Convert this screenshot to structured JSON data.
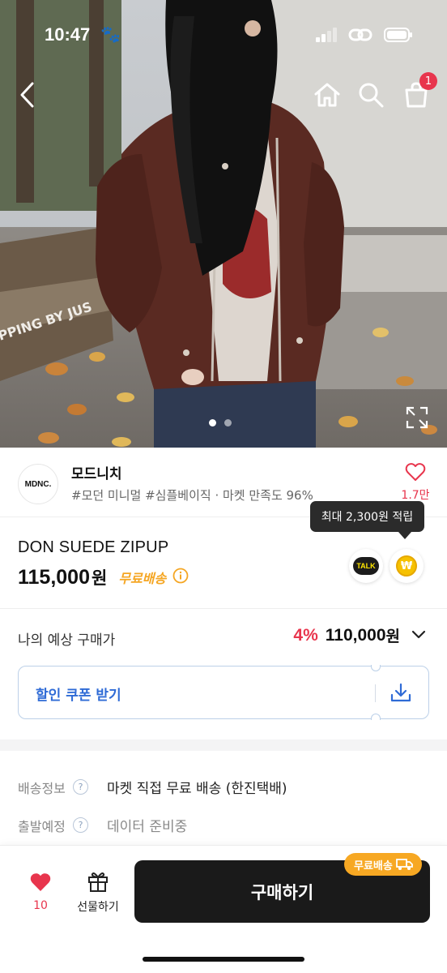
{
  "status_bar": {
    "time": "10:47",
    "paw": "🐾"
  },
  "hero": {
    "cart_count": "1",
    "total_images": 2,
    "active_image": 1
  },
  "shop": {
    "logo_text": "MDNC.",
    "name": "모드니치",
    "tags": "#모던 미니멀 #심플베이직 · 마켓 만족도 96%",
    "like_count": "1.7만"
  },
  "product": {
    "name": "DON SUEDE ZIPUP",
    "price": "115,000",
    "price_unit": "원",
    "free_shipping": "무료배송",
    "tooltip": "최대 2,300원 적립",
    "talk_label": "TALK",
    "point_symbol": "₩"
  },
  "expected": {
    "label": "나의 예상 구매가",
    "discount": "4%",
    "price": "110,000",
    "unit": "원"
  },
  "coupon": {
    "label": "할인 쿠폰 받기"
  },
  "shipping": {
    "rows": [
      {
        "key": "배송정보",
        "value": "마켓 직접 무료 배송 (한진택배)"
      },
      {
        "key": "출발예정",
        "value": "데이터 준비중"
      }
    ],
    "help": "?"
  },
  "bottom": {
    "wish_count": "10",
    "gift_label": "선물하기",
    "buy_label": "구매하기",
    "ship_badge": "무료배송"
  },
  "colors": {
    "accent_red": "#e8354d",
    "accent_orange": "#f7a823",
    "accent_blue": "#2f6bd6",
    "button_dark": "#1a1a1a"
  }
}
